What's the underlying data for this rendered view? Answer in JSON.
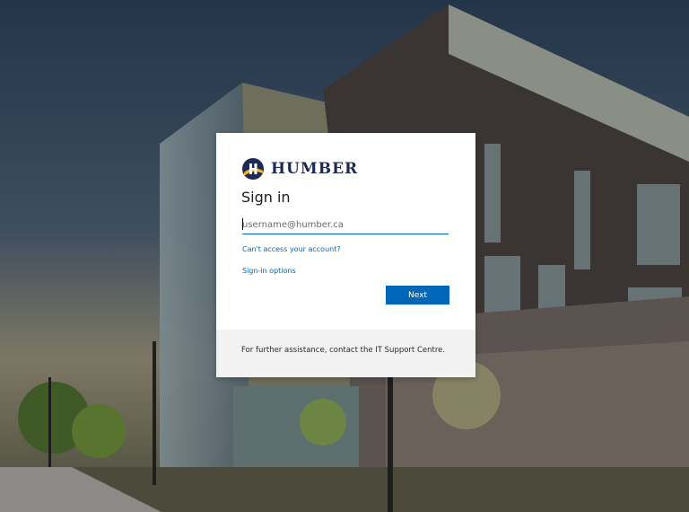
{
  "brand": {
    "name": "HUMBER",
    "mark_icon": "humber-h-logo-icon",
    "colors": {
      "navy": "#1c2a55",
      "gold": "#f2b61c"
    }
  },
  "signin": {
    "title": "Sign in",
    "username_placeholder": "username@humber.ca",
    "username_value": "",
    "cant_access_link": "Can't access your account?",
    "signin_options_link": "Sign-in options",
    "next_label": "Next"
  },
  "footer": {
    "text": "For further assistance, contact the IT Support Centre."
  },
  "theme": {
    "accent": "#0067b8",
    "footer_bg": "#f2f2f2"
  }
}
